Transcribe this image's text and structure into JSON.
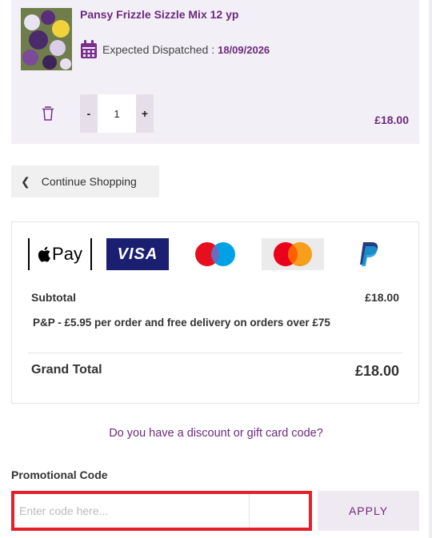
{
  "cart_item": {
    "title": "Pansy Frizzle Sizzle Mix 12 yp",
    "dispatch_label": "Expected Dispatched : ",
    "dispatch_date": "18/09/2026",
    "quantity": "1",
    "minus_label": "-",
    "plus_label": "+",
    "price": "£18.00",
    "icons": {
      "calendar": "calendar-icon",
      "delete": "trash-icon"
    }
  },
  "continue_shopping": {
    "label": "Continue Shopping",
    "icon": "chevron-left-icon"
  },
  "payment_methods": {
    "apple_pay": "Pay",
    "visa": "VISA",
    "others": [
      "maestro-logo",
      "mastercard-logo",
      "paypal-logo"
    ]
  },
  "summary": {
    "subtotal_label": "Subtotal",
    "subtotal_value": "£18.00",
    "pp_note": "P&P - £5.95 per order and free delivery on orders over £75",
    "grand_total_label": "Grand Total",
    "grand_total_value": "£18.00"
  },
  "discount": {
    "link_text": "Do you have a discount or gift card code?"
  },
  "promo": {
    "label": "Promotional Code",
    "placeholder": "Enter code here...",
    "apply_label": "APPLY"
  },
  "colors": {
    "accent": "#6b2a7c",
    "highlight": "#e4212b",
    "item_bg": "#f3eff6"
  }
}
